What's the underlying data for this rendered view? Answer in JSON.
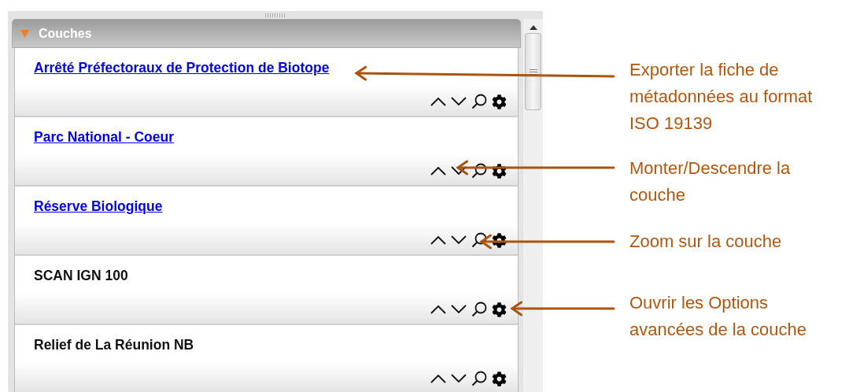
{
  "panel": {
    "title": "Couches",
    "expanded": true,
    "layers": [
      {
        "name": "Arrêté Préfectoraux de Protection de Biotope",
        "linked": true
      },
      {
        "name": "Parc National - Coeur",
        "linked": true
      },
      {
        "name": "Réserve Biologique",
        "linked": true
      },
      {
        "name": "SCAN IGN 100",
        "linked": false
      },
      {
        "name": "Relief de La Réunion NB",
        "linked": false
      }
    ]
  },
  "annotations": [
    {
      "text": "Exporter la fiche de métadonnées au format ISO 19139"
    },
    {
      "text": "Monter/Descendre la couche"
    },
    {
      "text": "Zoom sur la couche"
    },
    {
      "text": "Ouvrir les Options avancées de la couche"
    }
  ]
}
